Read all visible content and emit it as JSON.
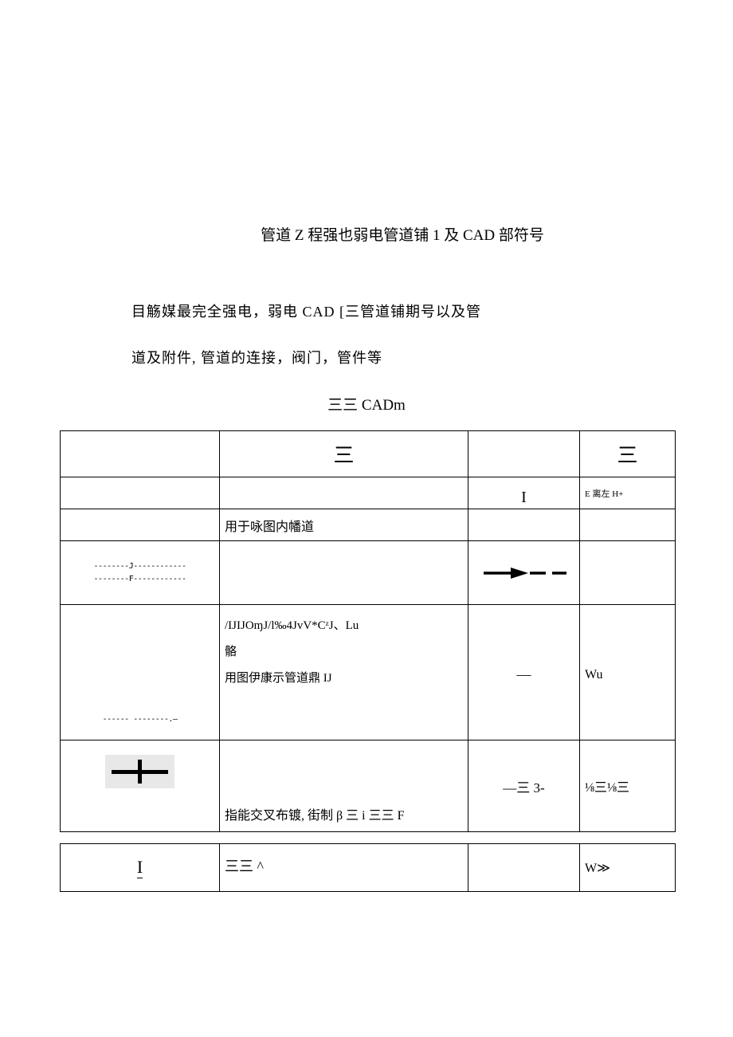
{
  "title": "管道 Z 程强也弱电管道铺 1 及 CAD 部符号",
  "intro_p1": "目觞媒最完全强电，弱电 CAD [三管道铺期号以及管",
  "intro_p2": "道及附件, 管道的连接，阀门，管件等",
  "subtitle": "三三 CADm",
  "table1": {
    "header": {
      "c1": "",
      "c2": "三",
      "c3": "",
      "c4": "三"
    },
    "row2": {
      "c1": "",
      "c2": "",
      "c3": "I",
      "c4": "E 离左 H+"
    },
    "row3": {
      "c1": "",
      "c2": "用于咏图内幡道",
      "c3": "",
      "c4": ""
    },
    "row4": {
      "c1_line1": "--------J------------",
      "c1_line2": "--------F------------",
      "c2": "",
      "c3": "",
      "c4": ""
    },
    "row5": {
      "c1": "------ --------.—",
      "c2_line1": "/IJIJOɱJ/l‰4JvV*CᶻJ、Lu",
      "c2_line2": "骼",
      "c2_line3": "用图伊康示管道鼎 IJ",
      "c3": "—",
      "c4": "Wu"
    },
    "row6": {
      "c1": "",
      "c2": "指能交叉布镀, 街制 β 三 i 三三 F",
      "c3": "—三 3-",
      "c4": "⅛三⅛三"
    }
  },
  "table2": {
    "c1": "I",
    "c2": "三三 ^",
    "c3": "",
    "c4": "W≫"
  }
}
